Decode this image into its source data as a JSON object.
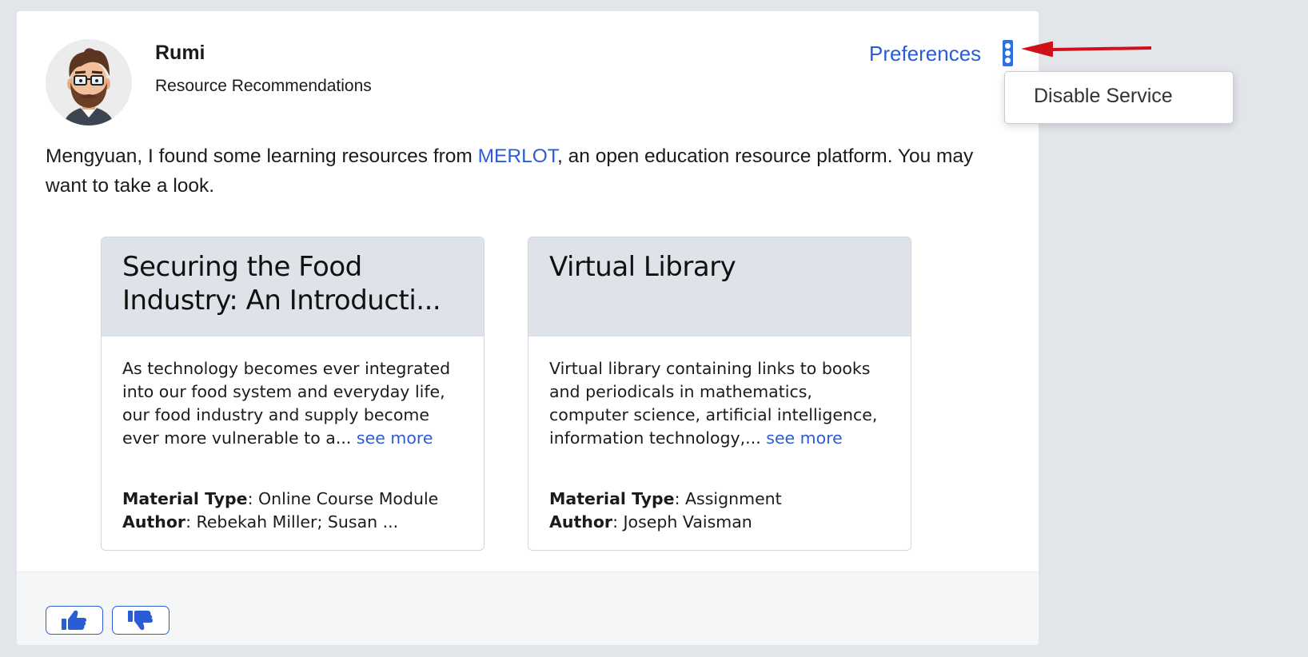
{
  "header": {
    "bot_name": "Rumi",
    "subtitle": "Resource Recommendations",
    "preferences_label": "Preferences",
    "more_options_icon": "vertical-ellipsis-icon"
  },
  "message": {
    "prefix": "Mengyuan, I found some learning resources from ",
    "link_text": "MERLOT",
    "suffix": ", an open education resource platform. You may want to take a look."
  },
  "resources": [
    {
      "title": "Securing the Food Industry: An Introducti...",
      "description": "As technology becomes ever integrated into our food system and everyday life, our food industry and supply become ever more vulnerable to a...",
      "see_more": "see more",
      "material_type_label": "Material Type",
      "material_type": "Online Course Module",
      "author_label": "Author",
      "author": "Rebekah Miller; Susan ..."
    },
    {
      "title": "Virtual Library",
      "description": "Virtual library containing links to books and periodicals in mathematics, computer science, artificial intelligence, information technology,...",
      "see_more": "see more",
      "material_type_label": "Material Type",
      "material_type": "Assignment",
      "author_label": "Author",
      "author": "Joseph Vaisman"
    }
  ],
  "footer": {
    "thumbs_up_icon": "thumbs-up-icon",
    "thumbs_down_icon": "thumbs-down-icon"
  },
  "dropdown": {
    "items": [
      "Disable Service"
    ]
  },
  "colors": {
    "accent": "#2a5cd6",
    "background": "#e2e5ea",
    "card_header": "#dee3ea",
    "annotation_arrow": "#d0111b"
  }
}
